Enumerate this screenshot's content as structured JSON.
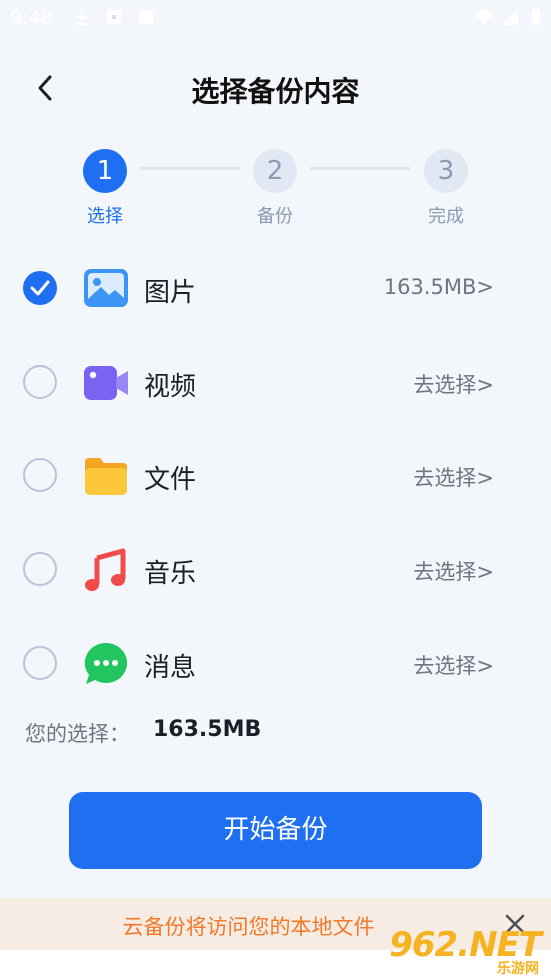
{
  "status_bar": {
    "time": "9:48"
  },
  "header": {
    "title": "选择备份内容",
    "back_icon": "chevron-left-icon"
  },
  "stepper": {
    "steps": [
      {
        "number": "1",
        "label": "选择",
        "state": "active"
      },
      {
        "number": "2",
        "label": "备份",
        "state": "inactive"
      },
      {
        "number": "3",
        "label": "完成",
        "state": "inactive"
      }
    ]
  },
  "items": [
    {
      "label": "图片",
      "right": "163.5MB>",
      "selected": true,
      "icon": "image-icon"
    },
    {
      "label": "视频",
      "right": "去选择>",
      "selected": false,
      "icon": "video-icon"
    },
    {
      "label": "文件",
      "right": "去选择>",
      "selected": false,
      "icon": "folder-icon"
    },
    {
      "label": "音乐",
      "right": "去选择>",
      "selected": false,
      "icon": "music-icon"
    },
    {
      "label": "消息",
      "right": "去选择>",
      "selected": false,
      "icon": "message-icon"
    }
  ],
  "summary": {
    "label": "您的选择：",
    "value": "163.5MB"
  },
  "start_button": {
    "label": "开始备份"
  },
  "notice": {
    "text": "云备份将访问您的本地文件"
  },
  "watermark": {
    "main": "962.NET",
    "sub": "乐游网"
  },
  "colors": {
    "accent": "#1f6ff2",
    "notice_text": "#f07a28",
    "notice_bg": "#f7ece3",
    "background": "#f3f6fb"
  }
}
